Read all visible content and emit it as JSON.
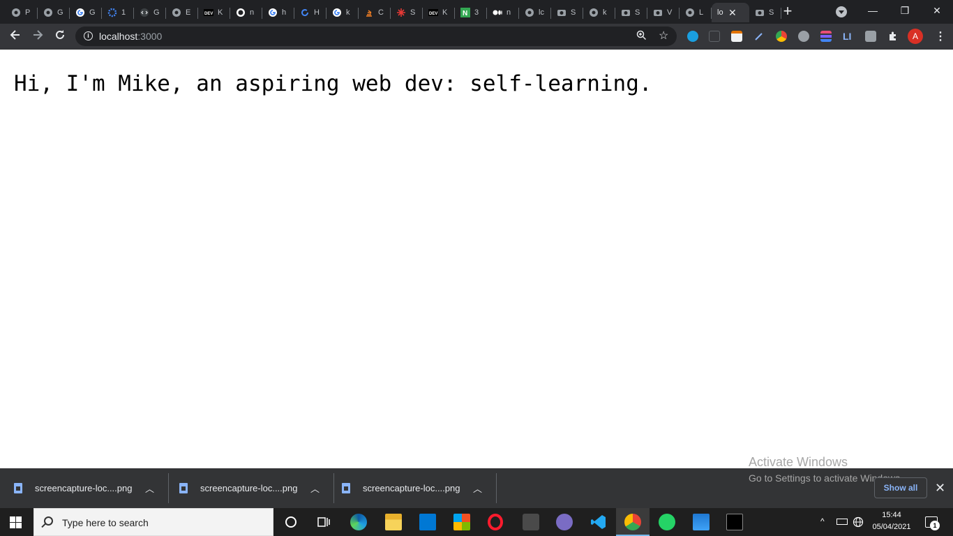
{
  "browser": {
    "tabs": [
      {
        "icon": "globe-icon",
        "label": "P"
      },
      {
        "icon": "globe-icon",
        "label": "G"
      },
      {
        "icon": "google-icon",
        "label": "G"
      },
      {
        "icon": "gear-icon",
        "label": "1"
      },
      {
        "icon": "code-icon",
        "label": "G"
      },
      {
        "icon": "globe-icon",
        "label": "E"
      },
      {
        "icon": "dev-icon",
        "label": "K"
      },
      {
        "icon": "github-icon",
        "label": "n"
      },
      {
        "icon": "google-icon",
        "label": "h"
      },
      {
        "icon": "refresh-icon",
        "label": "H"
      },
      {
        "icon": "google-icon",
        "label": "k"
      },
      {
        "icon": "stackoverflow-icon",
        "label": "C"
      },
      {
        "icon": "asterisk-icon",
        "label": "S"
      },
      {
        "icon": "dev-icon",
        "label": "K"
      },
      {
        "icon": "n-icon",
        "label": "3"
      },
      {
        "icon": "medium-icon",
        "label": "n"
      },
      {
        "icon": "globe-icon",
        "label": "lc"
      },
      {
        "icon": "camera-icon",
        "label": "S"
      },
      {
        "icon": "globe-icon",
        "label": "k"
      },
      {
        "icon": "camera-icon",
        "label": "S"
      },
      {
        "icon": "camera-icon",
        "label": "V"
      },
      {
        "icon": "globe-icon",
        "label": "L"
      },
      {
        "icon": "",
        "label": "lo",
        "active": true
      },
      {
        "icon": "camera-icon",
        "label": "S"
      }
    ],
    "new_tab": "+",
    "window_controls": {
      "minimize": "—",
      "restore": "❐",
      "close": "✕"
    },
    "url_host": "localhost",
    "url_port": ":3000",
    "profile_initial": "A"
  },
  "page": {
    "greeting": "Hi, I'm Mike, an aspiring web dev: self-learning."
  },
  "downloads": {
    "items": [
      {
        "name": "screencapture-loc....png"
      },
      {
        "name": "screencapture-loc....png"
      },
      {
        "name": "screencapture-loc....png"
      }
    ],
    "show_all": "Show all"
  },
  "watermark": {
    "line1": "Activate Windows",
    "line2": "Go to Settings to activate Windows."
  },
  "taskbar": {
    "search_placeholder": "Type here to search",
    "time": "15:44",
    "date": "05/04/2021",
    "notification_count": "1"
  },
  "colors": {
    "tabstrip": "#202124",
    "toolbar": "#35363a",
    "shelf": "#333436",
    "taskbar": "#1f1f1f",
    "link_blue": "#8ab4f8"
  }
}
